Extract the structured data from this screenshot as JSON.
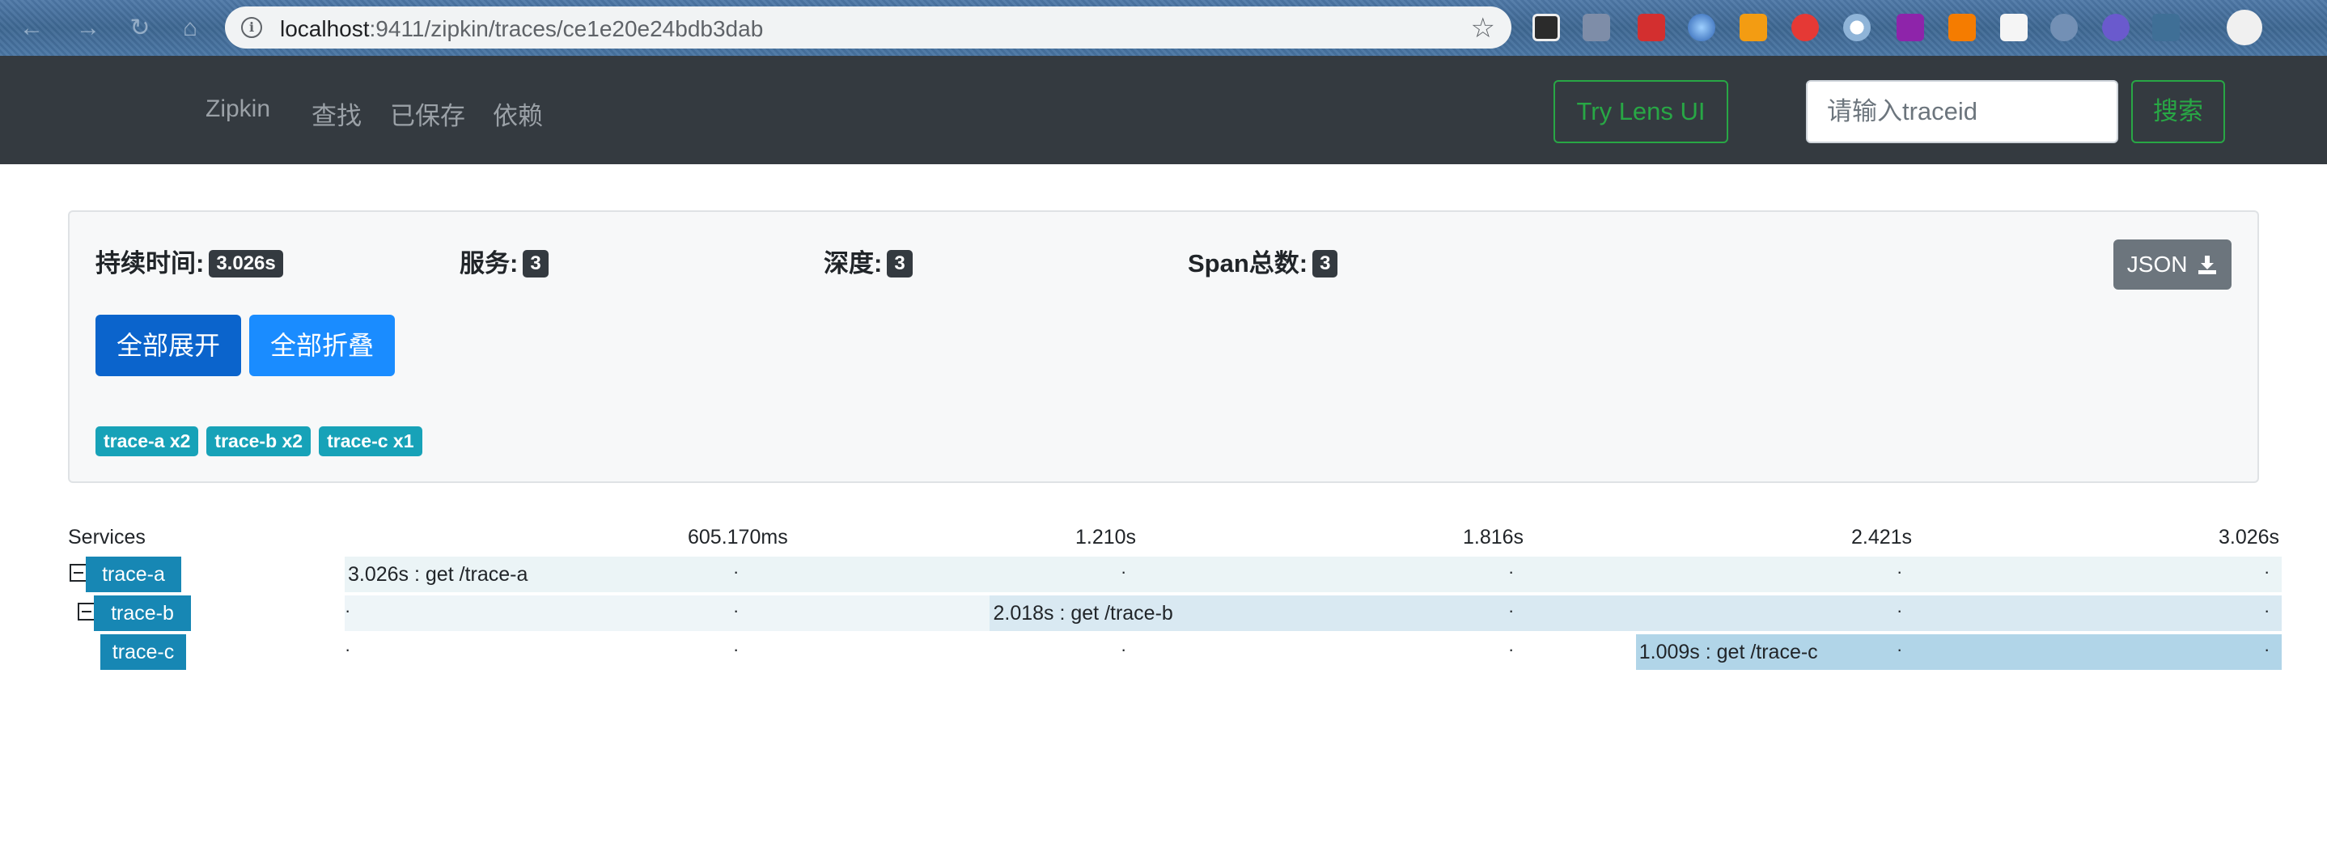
{
  "browser": {
    "url_host": "localhost",
    "url_path": ":9411/zipkin/traces/ce1e20e24bdb3dab"
  },
  "navbar": {
    "brand": "Zipkin",
    "links": [
      "查找",
      "已保存",
      "依赖"
    ],
    "lens_button": "Try Lens UI",
    "search_placeholder": "请输入traceid",
    "search_button": "搜索"
  },
  "summary": {
    "duration_label": "持续时间:",
    "duration_value": "3.026s",
    "services_label": "服务:",
    "services_value": "3",
    "depth_label": "深度:",
    "depth_value": "3",
    "spans_label": "Span总数:",
    "spans_value": "3",
    "json_button": "JSON",
    "expand_all": "全部展开",
    "collapse_all": "全部折叠",
    "service_badges": [
      "trace-a x2",
      "trace-b x2",
      "trace-c x1"
    ]
  },
  "timeline": {
    "services_header": "Services",
    "ticks": [
      "605.170ms",
      "1.210s",
      "1.816s",
      "2.421s",
      "3.026s"
    ],
    "rows": [
      {
        "service": "trace-a",
        "label": "3.026s : get /trace-a",
        "start": 0,
        "duration": 3.026
      },
      {
        "service": "trace-b",
        "label": "2.018s : get /trace-b",
        "start": 1.008,
        "duration": 2.018
      },
      {
        "service": "trace-c",
        "label": "1.009s : get /trace-c",
        "start": 2.017,
        "duration": 1.009
      }
    ],
    "total": 3.026,
    "colors": {
      "row_a": "#ebf4f6",
      "row_b": "#d9e9f2",
      "row_c": "#b1d5e8",
      "service": "#1787b4"
    }
  }
}
